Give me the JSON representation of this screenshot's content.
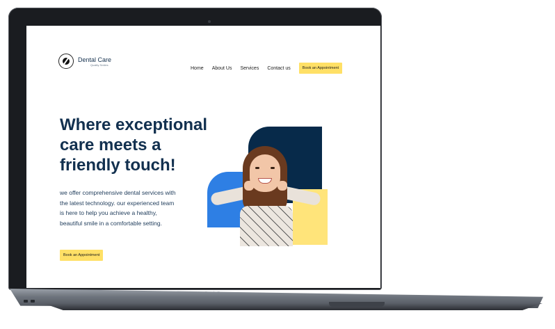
{
  "device": {
    "label": "MacBook Pro"
  },
  "brand": {
    "name": "Dental Care",
    "tagline": "Quality Smiles"
  },
  "nav": {
    "items": [
      {
        "label": "Home"
      },
      {
        "label": "About Us"
      },
      {
        "label": "Services"
      },
      {
        "label": "Contact us"
      }
    ],
    "cta": "Book an Appointment"
  },
  "hero": {
    "title": "Where exceptional care meets a friendly touch!",
    "copy": "we offer comprehensive dental services with the latest technology. our experienced team is here to help you achieve a healthy, beautiful smile in a comfortable setting.",
    "cta": "Book an Appointment"
  },
  "colors": {
    "navy": "#072a4a",
    "blue": "#2e7fe4",
    "yellow": "#ffe066",
    "text": "#12304f"
  }
}
